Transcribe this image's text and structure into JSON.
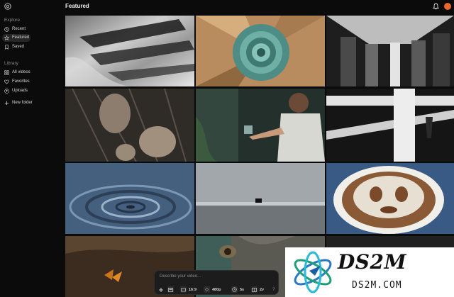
{
  "header": {
    "page_title": "Featured",
    "logo_icon": "spiral-logo-icon",
    "bell_icon": "bell-icon",
    "avatar_color": "#e8672c"
  },
  "sidebar": {
    "explore_label": "Explore",
    "explore_items": [
      {
        "label": "Recent",
        "icon": "clock-icon",
        "active": false
      },
      {
        "label": "Featured",
        "icon": "star-icon",
        "active": true
      },
      {
        "label": "Saved",
        "icon": "bookmark-icon",
        "active": false
      }
    ],
    "library_label": "Library",
    "library_items": [
      {
        "label": "All videos",
        "icon": "grid-icon"
      },
      {
        "label": "Favorites",
        "icon": "heart-icon"
      },
      {
        "label": "Uploads",
        "icon": "upload-icon"
      }
    ],
    "new_folder_label": "New folder"
  },
  "gallery": {
    "tiles": [
      "grey-leaves",
      "paper-spiral",
      "architecture-columns",
      "dark-plant",
      "woman-glass-cube",
      "white-beams",
      "water-ripples",
      "piano-on-beach",
      "coffee-cup-face",
      "butterfly",
      "monkey-eye",
      "dark-tile"
    ]
  },
  "prompt_bar": {
    "placeholder": "Describe your video...",
    "add_icon": "plus-icon",
    "image_icon": "image-icon",
    "aspect_ratio": "16:9",
    "resolution": "480p",
    "duration": "5s",
    "variations": "2v",
    "help": "?"
  },
  "watermark": {
    "line1": "DS2M",
    "line2": "DS2M.COM"
  }
}
